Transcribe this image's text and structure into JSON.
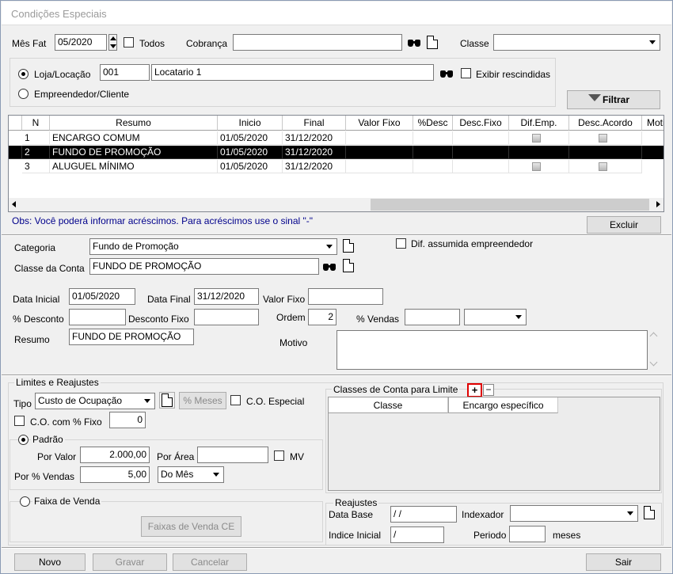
{
  "window": {
    "title": "Condições Especiais"
  },
  "filters": {
    "mes_fat_label": "Mês Fat",
    "mes_fat_value": "05/2020",
    "todos_label": "Todos",
    "cobranca_label": "Cobrança",
    "cobranca_value": "",
    "classe_label": "Classe",
    "classe_value": "",
    "loja_label": "Loja/Locação",
    "loja_code": "001",
    "loja_name": "Locatario 1",
    "exibir_label": "Exibir rescindidas",
    "empreendedor_label": "Empreendedor/Cliente",
    "filtrar_label": "Filtrar"
  },
  "grid": {
    "columns": [
      "N",
      "Resumo",
      "Inicio",
      "Final",
      "Valor Fixo",
      "%Desc",
      "Desc.Fixo",
      "Dif.Emp.",
      "Desc.Acordo",
      "Motivo"
    ],
    "rows": [
      {
        "n": "1",
        "resumo": "ENCARGO COMUM",
        "inicio": "01/05/2020",
        "final": "31/12/2020"
      },
      {
        "n": "2",
        "resumo": "FUNDO DE PROMOÇÃO",
        "inicio": "01/05/2020",
        "final": "31/12/2020"
      },
      {
        "n": "3",
        "resumo": "ALUGUEL MÍNIMO",
        "inicio": "01/05/2020",
        "final": "31/12/2020"
      }
    ],
    "selected_row": 2
  },
  "obs_text": "Obs: Você poderá informar acréscimos. Para acréscimos use o sinal \"-\"",
  "excluir_label": "Excluir",
  "detail": {
    "categoria_label": "Categoria",
    "categoria_value": "Fundo de Promoção",
    "dif_assumida_label": "Dif. assumida empreendedor",
    "classe_conta_label": "Classe da Conta",
    "classe_conta_value": "FUNDO DE PROMOÇÃO",
    "data_inicial_label": "Data Inicial",
    "data_inicial_value": "01/05/2020",
    "data_final_label": "Data Final",
    "data_final_value": "31/12/2020",
    "valor_fixo_label": "Valor Fixo",
    "valor_fixo_value": "",
    "desconto_label": "% Desconto",
    "desconto_fixo_label": "Desconto Fixo",
    "ordem_label": "Ordem",
    "ordem_value": "2",
    "vendas_label": "% Vendas",
    "resumo_label": "Resumo",
    "resumo_value": "FUNDO DE PROMOÇÃO",
    "motivo_label": "Motivo"
  },
  "limites": {
    "title": "Limites e Reajustes",
    "tipo_label": "Tipo",
    "tipo_value": "Custo de Ocupação",
    "meses_label": "% Meses",
    "co_especial_label": "C.O. Especial",
    "co_fixo_label": "C.O. com % Fixo",
    "co_fixo_value": "0",
    "padrao_label": "Padrão",
    "por_valor_label": "Por Valor",
    "por_valor_value": "2.000,00",
    "por_area_label": "Por Área",
    "mv_label": "MV",
    "por_vendas_label": "Por % Vendas",
    "por_vendas_value": "5,00",
    "periodo_combo_value": "Do Mês",
    "faixa_label": "Faixa de Venda",
    "faixas_button": "Faixas de Venda CE"
  },
  "classes_limite": {
    "title": "Classes de Conta para Limite",
    "add_symbol": "+",
    "remove_symbol": "−",
    "columns": [
      "Classe",
      "Encargo específico"
    ]
  },
  "reajustes": {
    "title": "Reajustes",
    "data_base_label": "Data Base",
    "data_base_value": "/ /",
    "indexador_label": "Indexador",
    "indice_label": "Indice Inicial",
    "indice_value": "/",
    "periodo_label": "Periodo",
    "meses_label": "meses"
  },
  "footer": {
    "novo": "Novo",
    "gravar": "Gravar",
    "cancelar": "Cancelar",
    "sair": "Sair"
  },
  "colors": {
    "highlight_box": "#e00000",
    "selected_row_bg": "#000000",
    "obs_text": "#00008b"
  }
}
